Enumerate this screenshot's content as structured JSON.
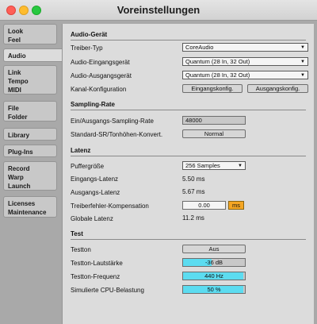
{
  "window": {
    "title": "Voreinstellungen"
  },
  "sidebar": {
    "tabs": [
      {
        "lines": [
          "Look",
          "Feel"
        ]
      },
      {
        "lines": [
          "Audio"
        ]
      },
      {
        "lines": [
          "Link",
          "Tempo",
          "MIDI"
        ]
      },
      {
        "lines": [
          "File",
          "Folder"
        ]
      },
      {
        "lines": [
          "Library"
        ]
      },
      {
        "lines": [
          "Plug-Ins"
        ]
      },
      {
        "lines": [
          "Record",
          "Warp",
          "Launch"
        ]
      },
      {
        "lines": [
          "Licenses",
          "Maintenance"
        ]
      }
    ],
    "active": "Audio"
  },
  "audio_device": {
    "title": "Audio-Gerät",
    "driver_type_label": "Treiber-Typ",
    "driver_type_value": "CoreAudio",
    "input_device_label": "Audio-Eingangsgerät",
    "input_device_value": "Quantum (28 In, 32 Out)",
    "output_device_label": "Audio-Ausgangsgerät",
    "output_device_value": "Quantum (28 In, 32 Out)",
    "channel_config_label": "Kanal-Konfiguration",
    "input_config_button": "Eingangskonfig.",
    "output_config_button": "Ausgangskonfig."
  },
  "sample_rate": {
    "title": "Sampling-Rate",
    "io_rate_label": "Ein/Ausgangs-Sampling-Rate",
    "io_rate_value": "48000",
    "default_sr_label": "Standard-SR/Tonhöhen-Konvert.",
    "default_sr_value": "Normal"
  },
  "latency": {
    "title": "Latenz",
    "buffer_size_label": "Puffergröße",
    "buffer_size_value": "256 Samples",
    "input_latency_label": "Eingangs-Latenz",
    "input_latency_value": "5.50 ms",
    "output_latency_label": "Ausgangs-Latenz",
    "output_latency_value": "5.67 ms",
    "driver_error_label": "Treiberfehler-Kompensation",
    "driver_error_value": "0.00",
    "driver_error_unit": "ms",
    "overall_latency_label": "Globale Latenz",
    "overall_latency_value": "11.2 ms"
  },
  "test": {
    "title": "Test",
    "test_tone_label": "Testton",
    "test_tone_value": "Aus",
    "tone_volume_label": "Testton-Lautstärke",
    "tone_volume_value": "-36 dB",
    "tone_volume_level": 0.46,
    "tone_freq_label": "Testton-Frequenz",
    "tone_freq_value": "440 Hz",
    "tone_freq_level": 0.98,
    "cpu_label": "Simulierte CPU-Belastung",
    "cpu_value": "50 %",
    "cpu_level": 0.98
  },
  "colors": {
    "accent_orange": "#f5a623",
    "slider_fill": "#5cdcf0"
  }
}
